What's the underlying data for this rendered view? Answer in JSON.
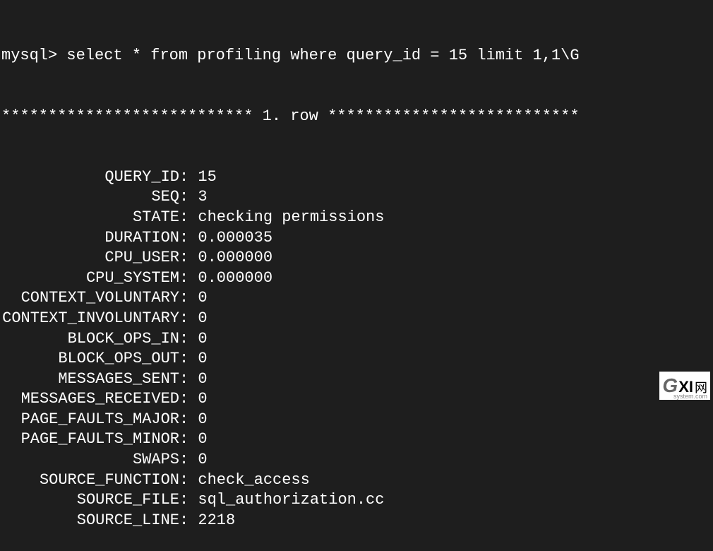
{
  "prompt": "mysql>",
  "query": "select * from profiling where query_id = 15 limit 1,1\\G",
  "row_header": "*************************** 1. row ***************************",
  "fields": [
    {
      "label": "QUERY_ID",
      "value": "15"
    },
    {
      "label": "SEQ",
      "value": "3"
    },
    {
      "label": "STATE",
      "value": "checking permissions"
    },
    {
      "label": "DURATION",
      "value": "0.000035"
    },
    {
      "label": "CPU_USER",
      "value": "0.000000"
    },
    {
      "label": "CPU_SYSTEM",
      "value": "0.000000"
    },
    {
      "label": "CONTEXT_VOLUNTARY",
      "value": "0"
    },
    {
      "label": "CONTEXT_INVOLUNTARY",
      "value": "0"
    },
    {
      "label": "BLOCK_OPS_IN",
      "value": "0"
    },
    {
      "label": "BLOCK_OPS_OUT",
      "value": "0"
    },
    {
      "label": "MESSAGES_SENT",
      "value": "0"
    },
    {
      "label": "MESSAGES_RECEIVED",
      "value": "0"
    },
    {
      "label": "PAGE_FAULTS_MAJOR",
      "value": "0"
    },
    {
      "label": "PAGE_FAULTS_MINOR",
      "value": "0"
    },
    {
      "label": "SWAPS",
      "value": "0"
    },
    {
      "label": "SOURCE_FUNCTION",
      "value": "check_access"
    },
    {
      "label": "SOURCE_FILE",
      "value": "sql_authorization.cc"
    },
    {
      "label": "SOURCE_LINE",
      "value": "2218"
    }
  ],
  "watermark": {
    "g": "G",
    "xi": "XI",
    "cn": "网",
    "sys": "system.com"
  }
}
